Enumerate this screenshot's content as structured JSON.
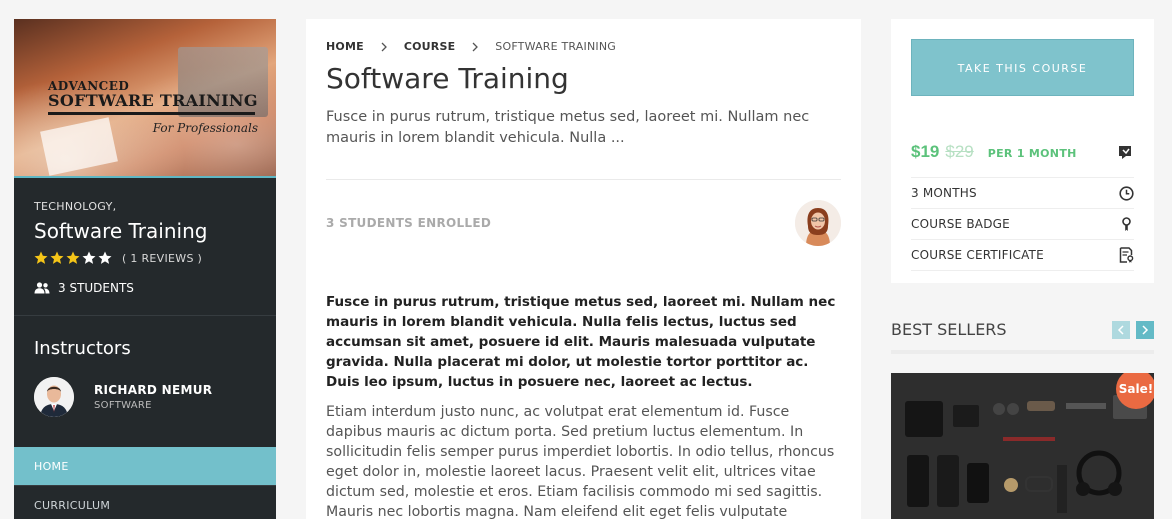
{
  "left": {
    "cover": {
      "line1": "ADVANCED",
      "line2": "SOFTWARE TRAINING",
      "line3": "For Professionals"
    },
    "category": "TECHNOLOGY,",
    "title": "Software Training",
    "rating": 3,
    "rating_max": 5,
    "reviews": "( 1 REVIEWS )",
    "students": "3 STUDENTS",
    "instructors_heading": "Instructors",
    "instructor": {
      "name": "RICHARD NEMUR",
      "role": "SOFTWARE"
    },
    "nav": [
      {
        "label": "HOME",
        "active": true
      },
      {
        "label": "CURRICULUM",
        "active": false
      }
    ]
  },
  "main": {
    "breadcrumb": [
      "HOME",
      "COURSE",
      "SOFTWARE TRAINING"
    ],
    "title": "Software Training",
    "excerpt": "Fusce in purus rutrum, tristique metus sed, laoreet mi. Nullam nec mauris in lorem blandit vehicula. Nulla ...",
    "enrolled": "3 STUDENTS ENROLLED",
    "bold_paragraph": "Fusce in purus rutrum, tristique metus sed, laoreet mi. Nullam nec mauris in lorem blandit vehicula. Nulla felis lectus, luctus sed accumsan sit amet, posuere id elit. Mauris malesuada vulputate gravida. Nulla placerat mi dolor, ut molestie tortor porttitor ac. Duis leo ipsum, luctus in posuere nec, laoreet ac lectus.",
    "body_paragraph": "Etiam interdum justo nunc, ac volutpat erat elementum id. Fusce dapibus mauris ac dictum porta. Sed pretium luctus elementum. In sollicitudin felis semper purus imperdiet lobortis. In odio tellus, rhoncus eget dolor in, molestie laoreet lacus. Praesent velit elit, ultrices vitae dictum sed, molestie et eros. Etiam facilisis commodo mi sed sagittis. Mauris nec lobortis magna. Nam eleifend elit eget felis vulputate facilisis. Donec sed nunc diam."
  },
  "right": {
    "take_course": "TAKE THIS COURSE",
    "price_now": "$19",
    "price_old": "$29",
    "price_period": "PER 1 MONTH",
    "features": [
      {
        "label": "3 MONTHS",
        "icon": "clock-icon"
      },
      {
        "label": "COURSE BADGE",
        "icon": "badge-icon"
      },
      {
        "label": "COURSE CERTIFICATE",
        "icon": "certificate-icon"
      }
    ],
    "best_sellers": "BEST SELLERS",
    "sale_badge": "Sale!"
  },
  "colors": {
    "accent": "#73c0cb",
    "sidebar_bg": "#24292c",
    "price_green": "#5cc27b",
    "sale_orange": "#ea6a42"
  }
}
